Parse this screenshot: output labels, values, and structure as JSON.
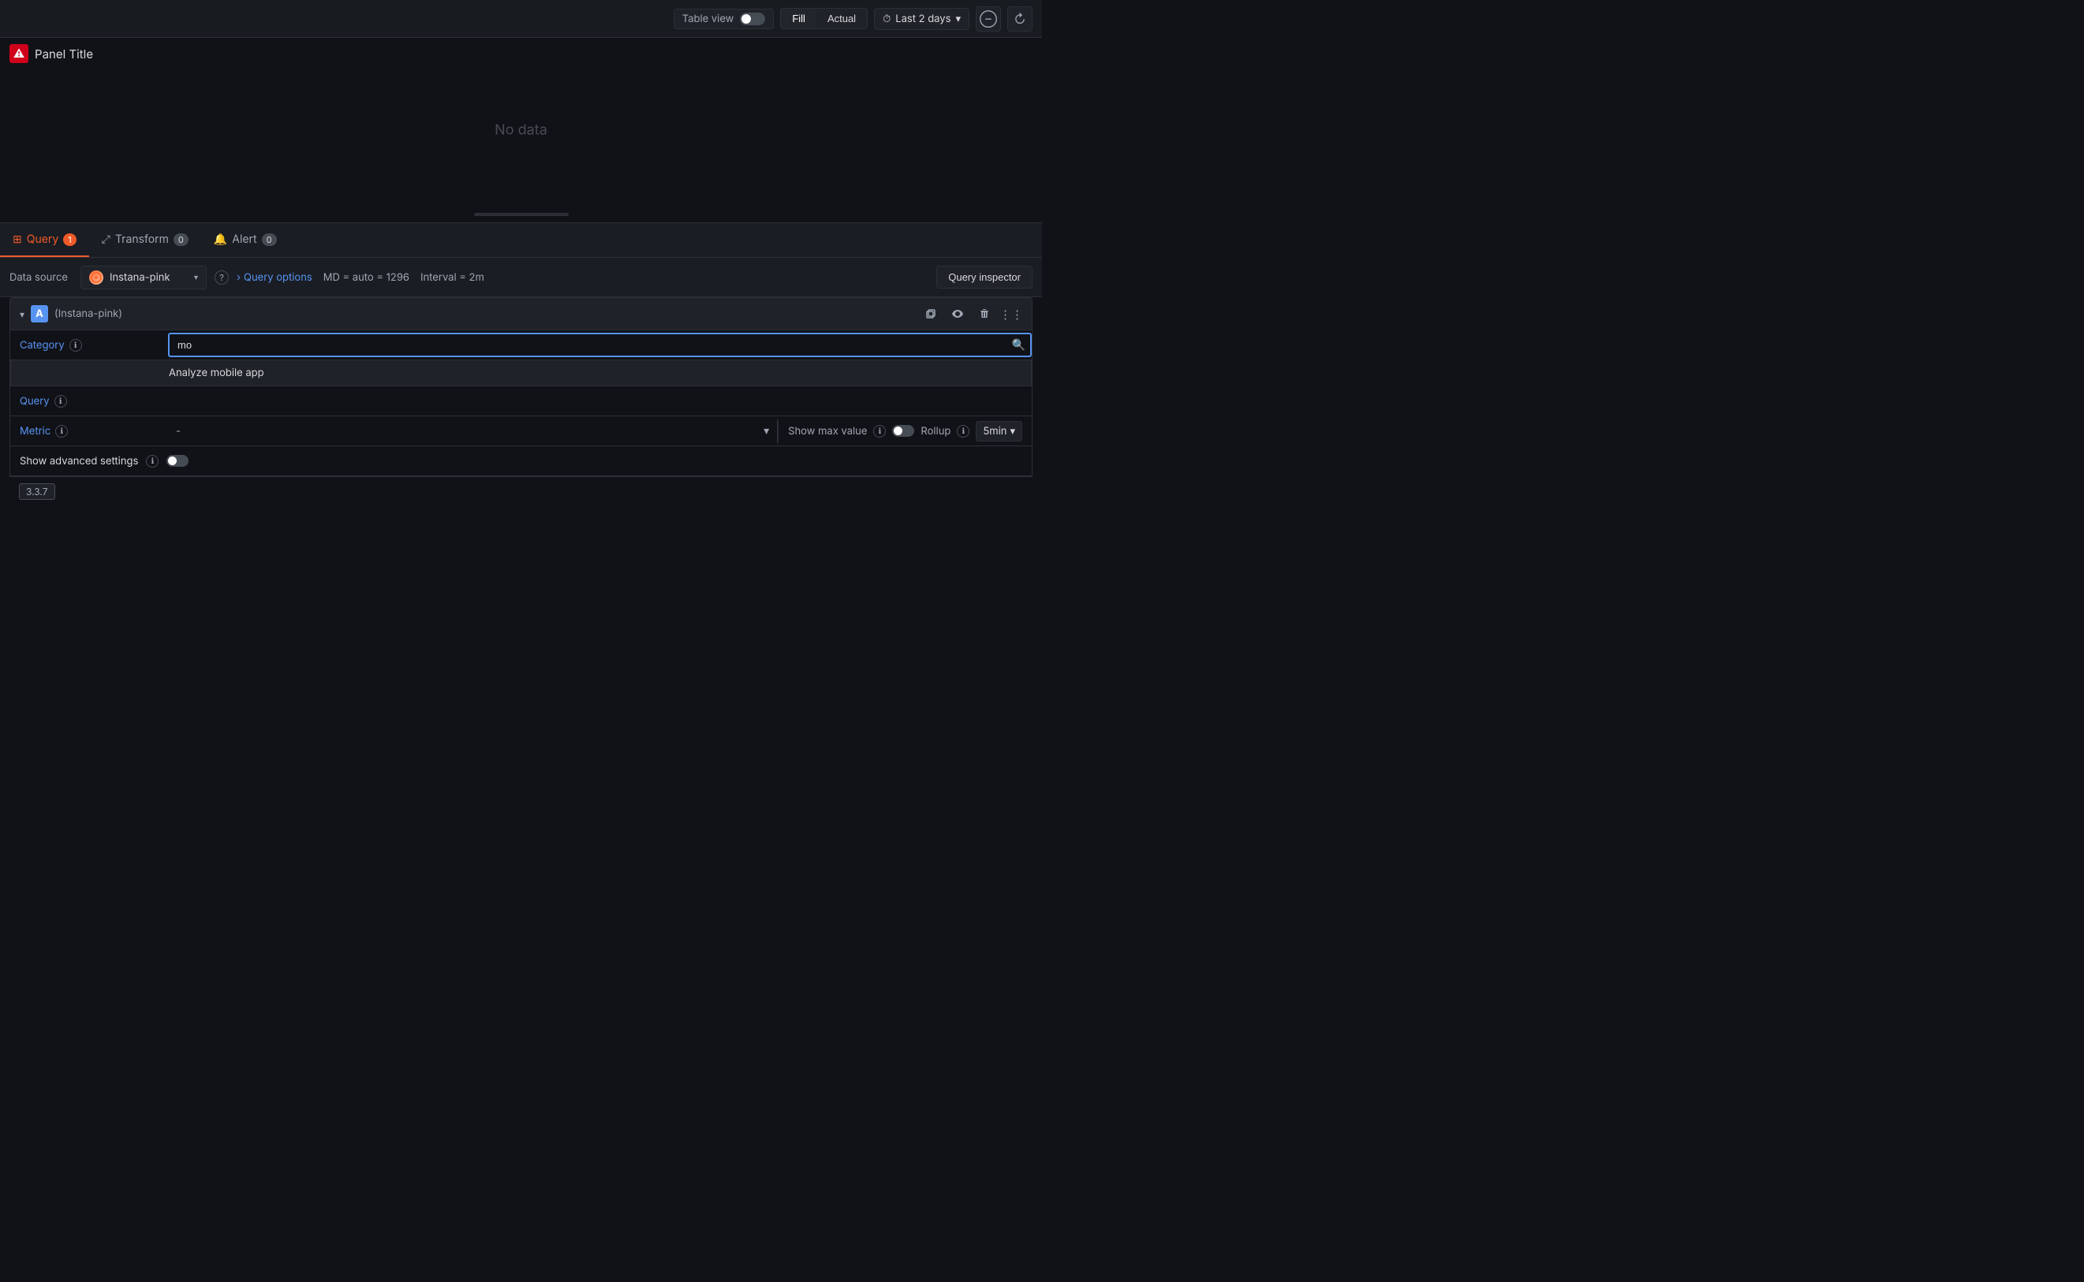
{
  "toolbar": {
    "table_view_label": "Table view",
    "fill_label": "Fill",
    "actual_label": "Actual",
    "time_range_label": "Last 2 days",
    "zoom_out_icon": "−",
    "refresh_icon": "↻",
    "clock_icon": "🕐"
  },
  "panel": {
    "title": "Panel Title",
    "no_data": "No data"
  },
  "tabs": [
    {
      "id": "query",
      "label": "Query",
      "count": "1",
      "active": true
    },
    {
      "id": "transform",
      "label": "Transform",
      "count": "0",
      "active": false
    },
    {
      "id": "alert",
      "label": "Alert",
      "count": "0",
      "active": false
    }
  ],
  "datasource_row": {
    "label": "Data source",
    "datasource_name": "Instana-pink",
    "query_options_label": "Query options",
    "md_meta": "MD = auto = 1296",
    "interval_meta": "Interval = 2m",
    "query_inspector_label": "Query inspector"
  },
  "query_block": {
    "letter": "A",
    "datasource_label": "(Instana-pink)",
    "fields": [
      {
        "id": "category",
        "label": "Category",
        "input_value": "mo",
        "input_placeholder": ""
      },
      {
        "id": "query",
        "label": "Query",
        "suggestion": "Analyze mobile app"
      },
      {
        "id": "metric",
        "label": "Metric",
        "select_value": "-"
      }
    ],
    "show_max_label": "Show max value",
    "rollup_label": "Rollup",
    "rollup_value": "5min",
    "advanced_label": "Show advanced settings",
    "version": "3.3.7"
  }
}
